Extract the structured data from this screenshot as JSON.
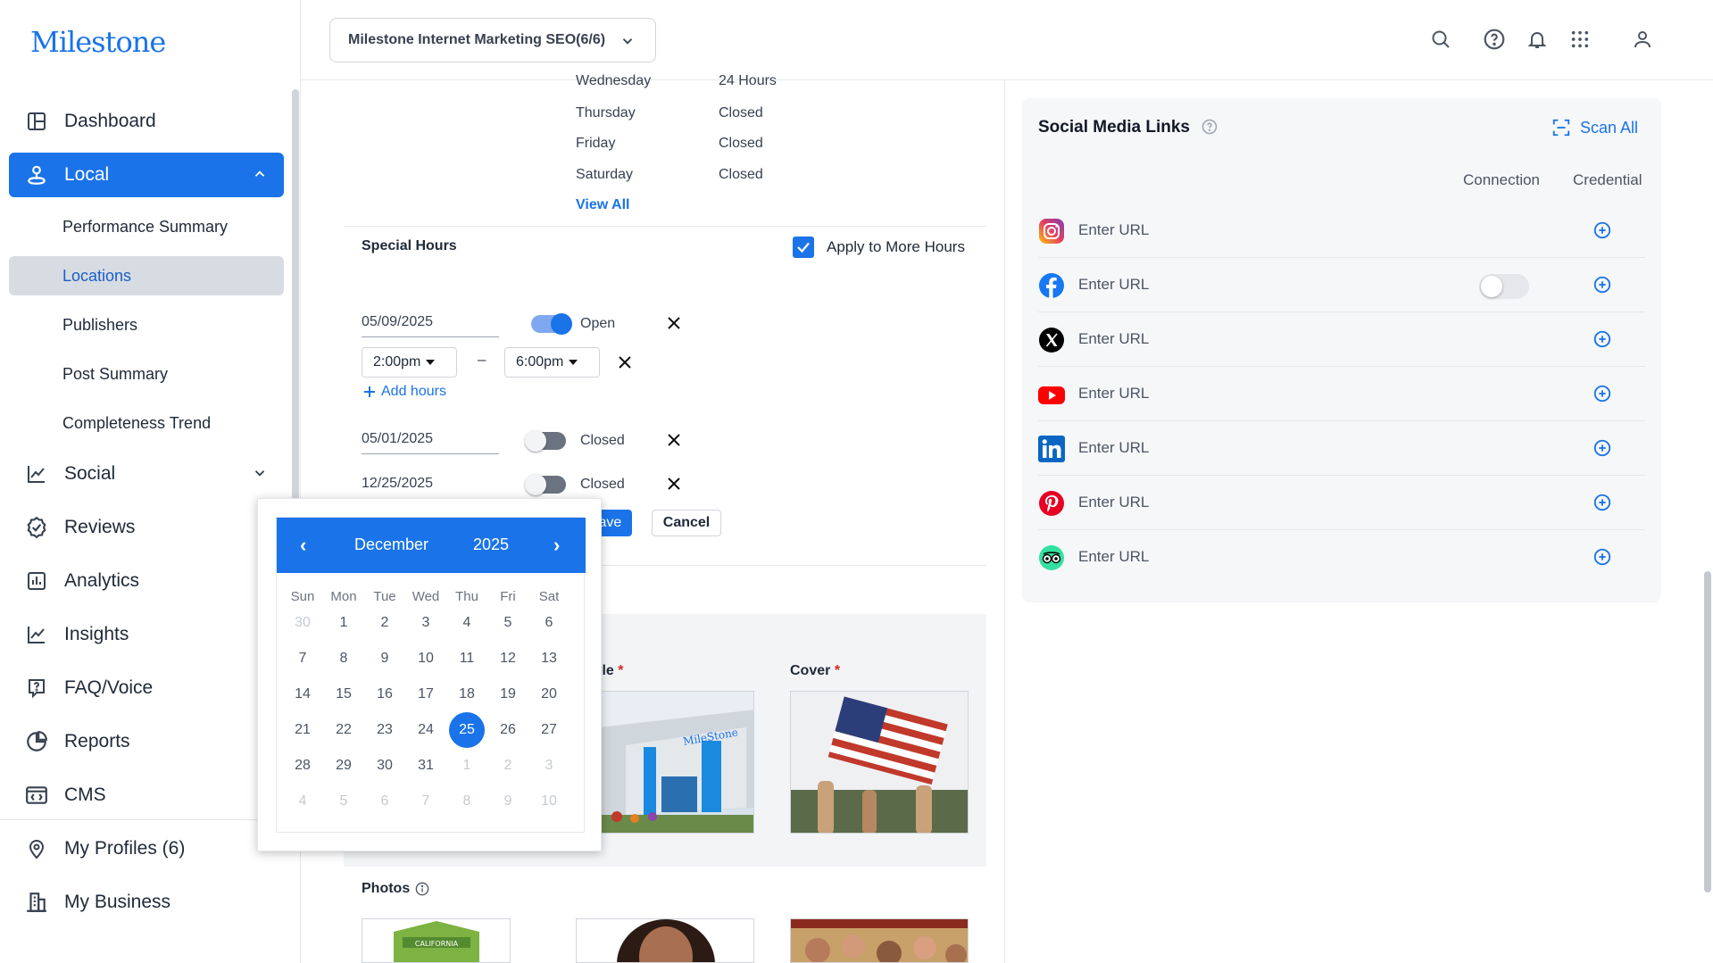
{
  "brand": {
    "logo_text": "Milestone"
  },
  "sidebar": {
    "items": [
      {
        "label": "Dashboard"
      },
      {
        "label": "Local"
      },
      {
        "label": "Social"
      },
      {
        "label": "Reviews"
      },
      {
        "label": "Analytics"
      },
      {
        "label": "Insights"
      },
      {
        "label": "FAQ/Voice"
      },
      {
        "label": "Reports"
      },
      {
        "label": "CMS"
      },
      {
        "label": "My Profiles (6)"
      },
      {
        "label": "My Business"
      }
    ],
    "local_sub": [
      {
        "label": "Performance Summary"
      },
      {
        "label": "Locations"
      },
      {
        "label": "Publishers"
      },
      {
        "label": "Post Summary"
      },
      {
        "label": "Completeness Trend"
      }
    ]
  },
  "topbar": {
    "account": "Milestone Internet Marketing SEO(6/6)"
  },
  "hours": {
    "rows": [
      {
        "day": "Wednesday",
        "value": "24 Hours"
      },
      {
        "day": "Thursday",
        "value": "Closed"
      },
      {
        "day": "Friday",
        "value": "Closed"
      },
      {
        "day": "Saturday",
        "value": "Closed"
      }
    ],
    "view_all": "View All"
  },
  "special_hours": {
    "title": "Special Hours",
    "apply_label": "Apply to More Hours",
    "entries": [
      {
        "date": "05/09/2025",
        "status": "Open",
        "open": true
      },
      {
        "date": "05/01/2025",
        "status": "Closed",
        "open": false
      },
      {
        "date": "12/25/2025",
        "status": "Closed",
        "open": false
      }
    ],
    "start_time": "2:00pm",
    "end_time": "6:00pm",
    "dash": "–",
    "add_hours": "Add hours",
    "save": "Save",
    "cancel": "Cancel"
  },
  "images": {
    "profile_label": "ile",
    "cover_label": "Cover",
    "required": "*",
    "photos_label": "Photos"
  },
  "datepicker": {
    "month": "December",
    "year": "2025",
    "prev": "‹",
    "next": "›",
    "weekdays": [
      "Sun",
      "Mon",
      "Tue",
      "Wed",
      "Thu",
      "Fri",
      "Sat"
    ],
    "weeks": [
      [
        "30",
        "1",
        "2",
        "3",
        "4",
        "5",
        "6"
      ],
      [
        "7",
        "8",
        "9",
        "10",
        "11",
        "12",
        "13"
      ],
      [
        "14",
        "15",
        "16",
        "17",
        "18",
        "19",
        "20"
      ],
      [
        "21",
        "22",
        "23",
        "24",
        "25",
        "26",
        "27"
      ],
      [
        "28",
        "29",
        "30",
        "31",
        "1",
        "2",
        "3"
      ],
      [
        "4",
        "5",
        "6",
        "7",
        "8",
        "9",
        "10"
      ]
    ],
    "selected": "25"
  },
  "social_links": {
    "title": "Social Media Links",
    "scan_all": "Scan All",
    "col_connection": "Connection",
    "col_credential": "Credential",
    "rows": [
      {
        "icon": "instagram-icon",
        "placeholder": "Enter URL"
      },
      {
        "icon": "facebook-icon",
        "placeholder": "Enter URL"
      },
      {
        "icon": "x-icon",
        "placeholder": "Enter URL"
      },
      {
        "icon": "youtube-icon",
        "placeholder": "Enter URL"
      },
      {
        "icon": "linkedin-icon",
        "placeholder": "Enter URL"
      },
      {
        "icon": "pinterest-icon",
        "placeholder": "Enter URL"
      },
      {
        "icon": "tripadvisor-icon",
        "placeholder": "Enter URL"
      }
    ]
  },
  "colors": {
    "accent": "#1a73e8"
  }
}
